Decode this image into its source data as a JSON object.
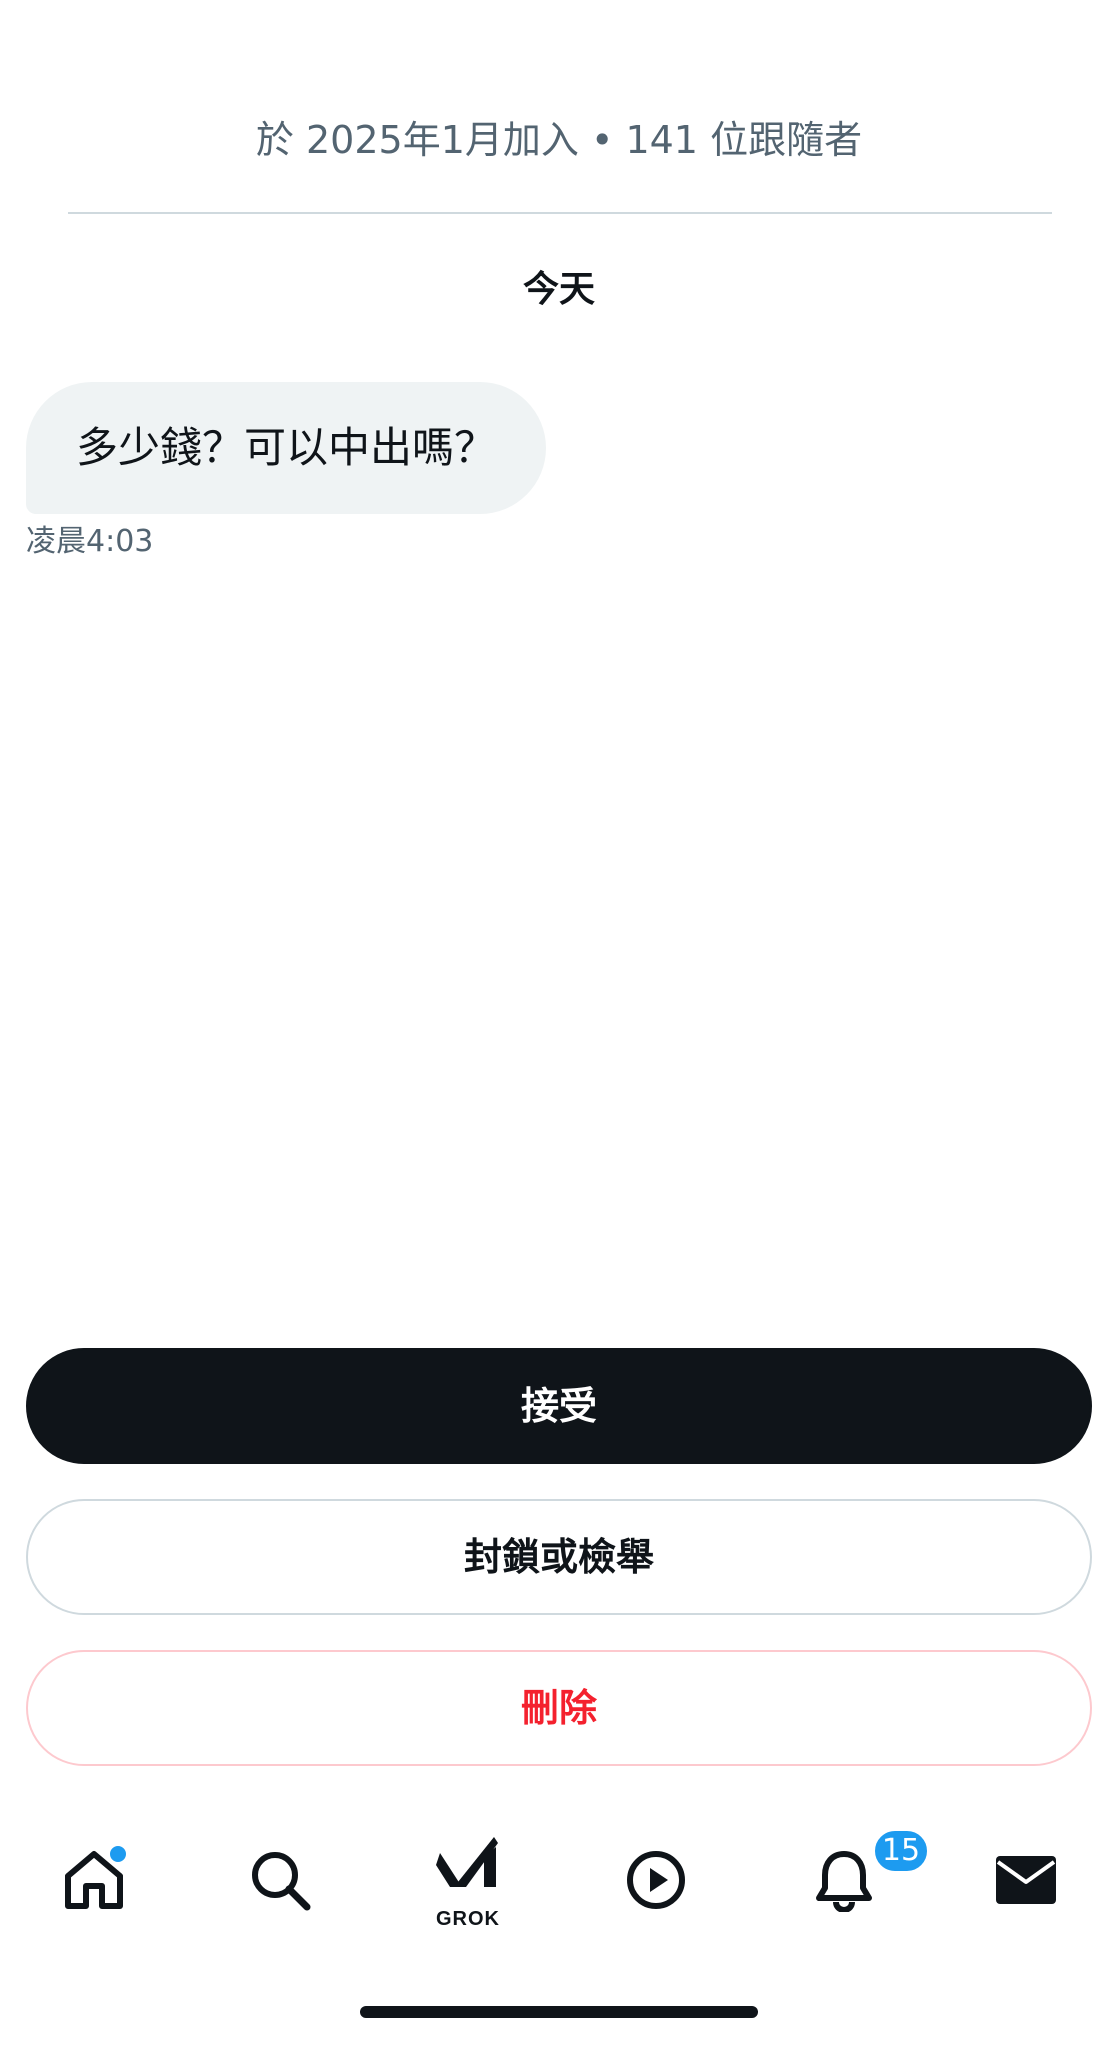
{
  "profile": {
    "meta": "於 2025年1月加入 • 141 位跟隨者"
  },
  "conversation": {
    "date_label": "今天",
    "messages": [
      {
        "text": "多少錢？可以中出嗎？",
        "time": "凌晨4:03",
        "direction": "incoming"
      }
    ]
  },
  "actions": {
    "accept_label": "接受",
    "block_report_label": "封鎖或檢舉",
    "delete_label": "刪除"
  },
  "tabbar": {
    "items": [
      {
        "icon": "home-icon",
        "has_dot": true
      },
      {
        "icon": "search-icon"
      },
      {
        "icon": "grok-icon",
        "label": "GROK"
      },
      {
        "icon": "play-icon"
      },
      {
        "icon": "bell-icon",
        "badge": "15"
      },
      {
        "icon": "mail-icon"
      }
    ]
  },
  "colors": {
    "accent": "#1d9bf0",
    "primary_button": "#0f1419",
    "danger": "#f4212e",
    "bubble_bg": "#eff3f4",
    "secondary_text": "#536471"
  }
}
